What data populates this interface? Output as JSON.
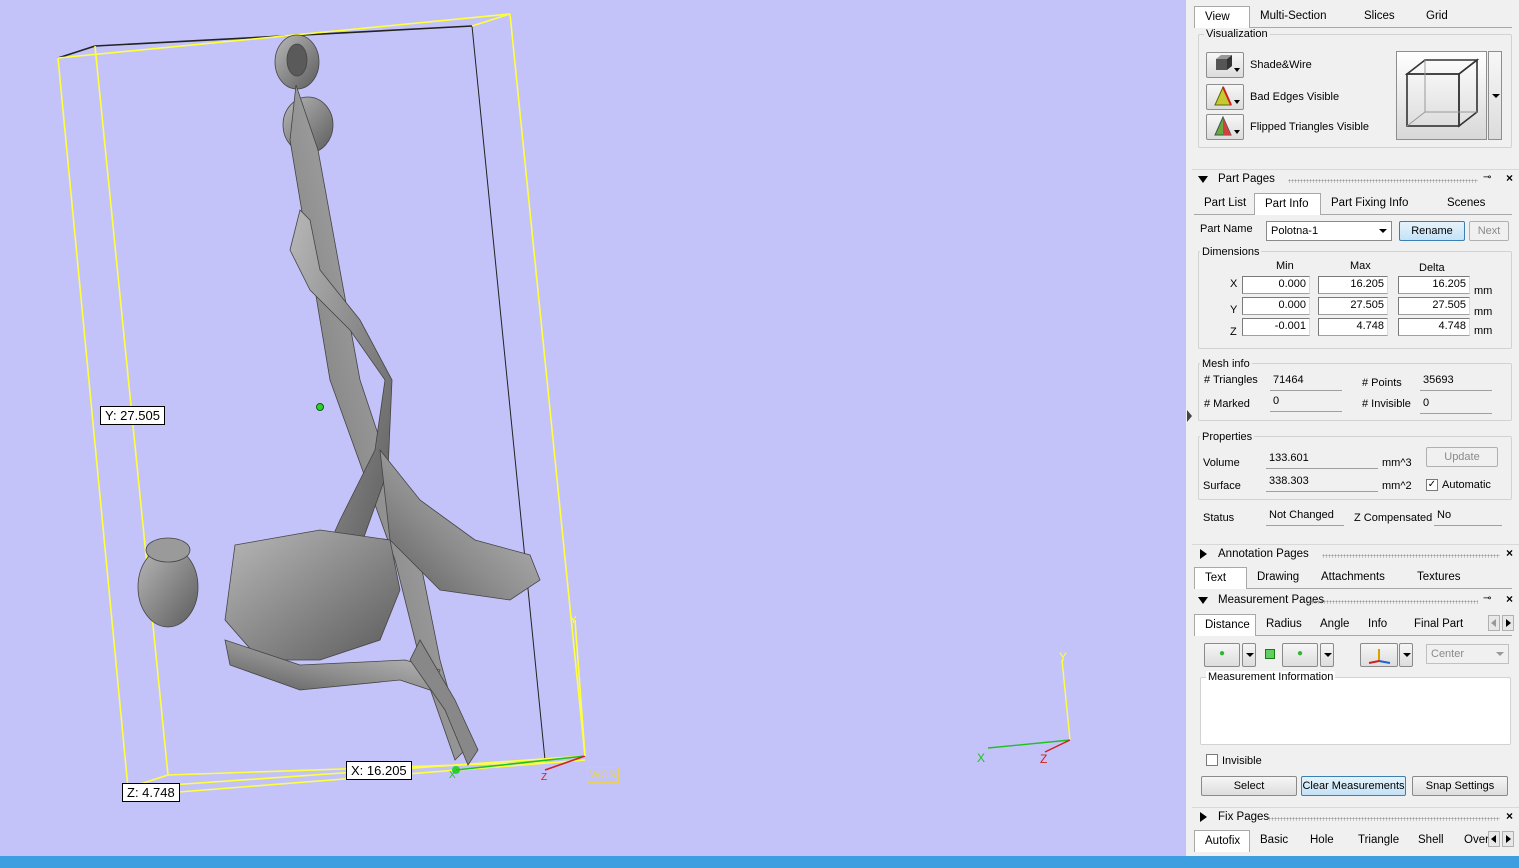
{
  "viewport": {
    "labels": {
      "y": "Y: 27.505",
      "x": "X: 16.205",
      "z": "Z: 4.748",
      "wcs": "WCS"
    },
    "axes": {
      "x": "X",
      "y": "Y",
      "z": "Z"
    },
    "background_color": "#c3c3f9",
    "bbox_color": "#ffff40"
  },
  "view_tabs": [
    "View",
    "Multi-Section",
    "Slices",
    "Grid"
  ],
  "visualization": {
    "title": "Visualization",
    "items": [
      {
        "label": "Shade&Wire",
        "icon": "shade-wire-icon"
      },
      {
        "label": "Bad Edges Visible",
        "icon": "bad-edges-icon"
      },
      {
        "label": "Flipped Triangles Visible",
        "icon": "flipped-triangles-icon"
      }
    ],
    "cube_icon": "view-cube-icon"
  },
  "part_pages": {
    "title": "Part Pages",
    "tabs": [
      "Part List",
      "Part Info",
      "Part Fixing Info",
      "Scenes"
    ],
    "part_name_label": "Part Name",
    "part_name": "Polotna-1",
    "rename": "Rename",
    "next": "Next",
    "dimensions": {
      "title": "Dimensions",
      "headers": [
        "Min",
        "Max",
        "Delta"
      ],
      "rows": [
        {
          "axis": "X",
          "min": "0.000",
          "max": "16.205",
          "delta": "16.205",
          "unit": "mm"
        },
        {
          "axis": "Y",
          "min": "0.000",
          "max": "27.505",
          "delta": "27.505",
          "unit": "mm"
        },
        {
          "axis": "Z",
          "min": "-0.001",
          "max": "4.748",
          "delta": "4.748",
          "unit": "mm"
        }
      ]
    },
    "mesh_info": {
      "title": "Mesh info",
      "triangles_label": "# Triangles",
      "triangles": "71464",
      "points_label": "# Points",
      "points": "35693",
      "marked_label": "# Marked",
      "marked": "0",
      "invisible_label": "# Invisible",
      "invisible": "0"
    },
    "properties": {
      "title": "Properties",
      "volume_label": "Volume",
      "volume": "133.601",
      "volume_unit": "mm^3",
      "surface_label": "Surface",
      "surface": "338.303",
      "surface_unit": "mm^2",
      "update": "Update",
      "automatic": "Automatic",
      "automatic_checked": true
    },
    "status_label": "Status",
    "status": "Not Changed",
    "z_comp_label": "Z Compensated",
    "z_comp": "No"
  },
  "annotation_pages": {
    "title": "Annotation Pages",
    "tabs": [
      "Text",
      "Drawing",
      "Attachments",
      "Textures"
    ]
  },
  "measurement_pages": {
    "title": "Measurement Pages",
    "tabs": [
      "Distance",
      "Radius",
      "Angle",
      "Info",
      "Final Part"
    ],
    "center": "Center",
    "info_title": "Measurement Information",
    "invisible": "Invisible",
    "select": "Select",
    "clear": "Clear Measurements",
    "snap": "Snap Settings"
  },
  "fix_pages": {
    "title": "Fix Pages",
    "tabs": [
      "Autofix",
      "Basic",
      "Hole",
      "Triangle",
      "Shell",
      "Over"
    ]
  }
}
